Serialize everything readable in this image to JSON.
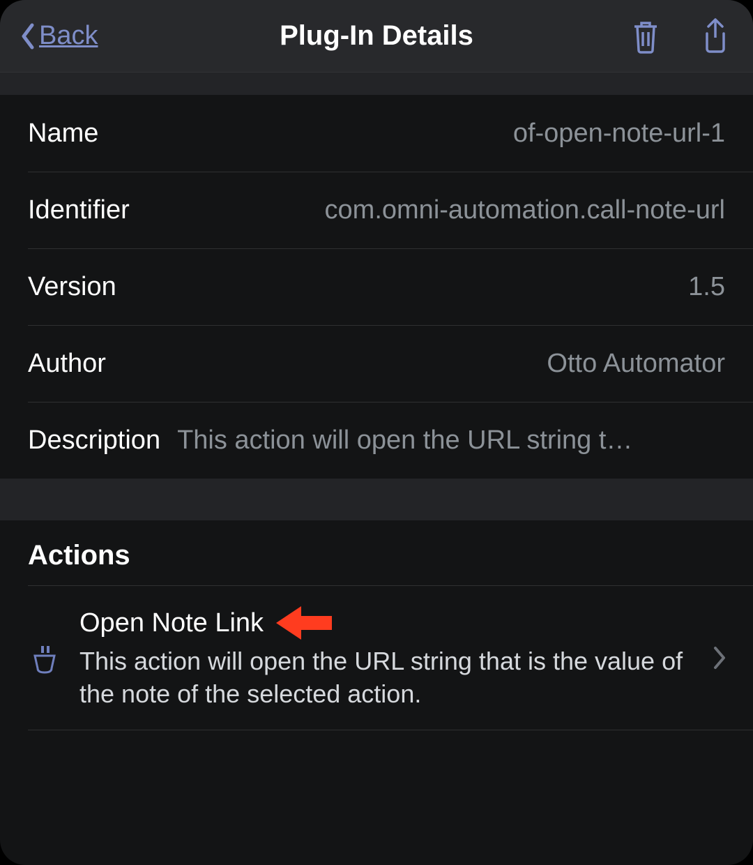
{
  "nav": {
    "back_label": "Back",
    "title": "Plug-In Details"
  },
  "details": {
    "name_label": "Name",
    "name_value": "of-open-note-url-1",
    "identifier_label": "Identifier",
    "identifier_value": "com.omni-automation.call-note-url",
    "version_label": "Version",
    "version_value": "1.5",
    "author_label": "Author",
    "author_value": "Otto Automator",
    "description_label": "Description",
    "description_value": "This action will open the URL string t…"
  },
  "actions_header": "Actions",
  "actions": [
    {
      "title": "Open Note Link",
      "desc": "This action will open the URL string that is the value of the note of the selected action."
    }
  ]
}
